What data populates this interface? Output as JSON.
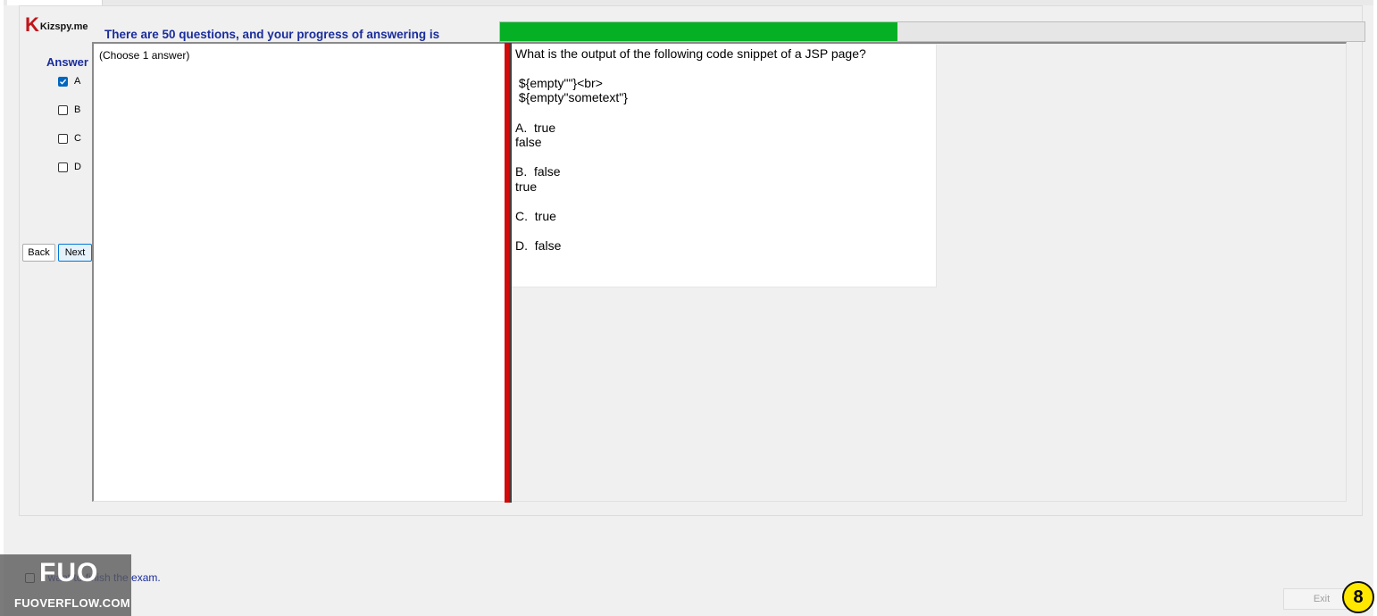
{
  "app": {
    "logo_letter": "K",
    "logo_name": "Kizspy.me"
  },
  "header": {
    "progress_label": "There are 50 questions, and your progress of answering is",
    "progress_fraction": 0.46,
    "progress_color": "#06b025"
  },
  "answer_panel": {
    "heading": "Answer",
    "options": [
      {
        "label": "A",
        "checked": true
      },
      {
        "label": "B",
        "checked": false
      },
      {
        "label": "C",
        "checked": false
      },
      {
        "label": "D",
        "checked": false
      }
    ],
    "back_label": "Back",
    "next_label": "Next"
  },
  "choose_pane": {
    "text": "(Choose 1 answer)"
  },
  "question": {
    "lines": [
      "What is the output of the following code snippet of a JSP page?",
      " ${empty\"\"}<br>",
      " ${empty\"sometext\"}",
      "A.  true",
      "false",
      "B.  false",
      "true",
      "C.  true",
      "D.  false"
    ]
  },
  "footer": {
    "finish_text": "I want to finish the exam.",
    "finish_checked": false,
    "exit_label": "Exit",
    "badge_number": "8"
  },
  "watermark": {
    "logo": "FUO",
    "text": "FUOVERFLOW.COM"
  },
  "colors": {
    "accent_blue": "#1a2d9c",
    "splitter_red": "#d10a0a",
    "badge_yellow": "#ffe800"
  }
}
